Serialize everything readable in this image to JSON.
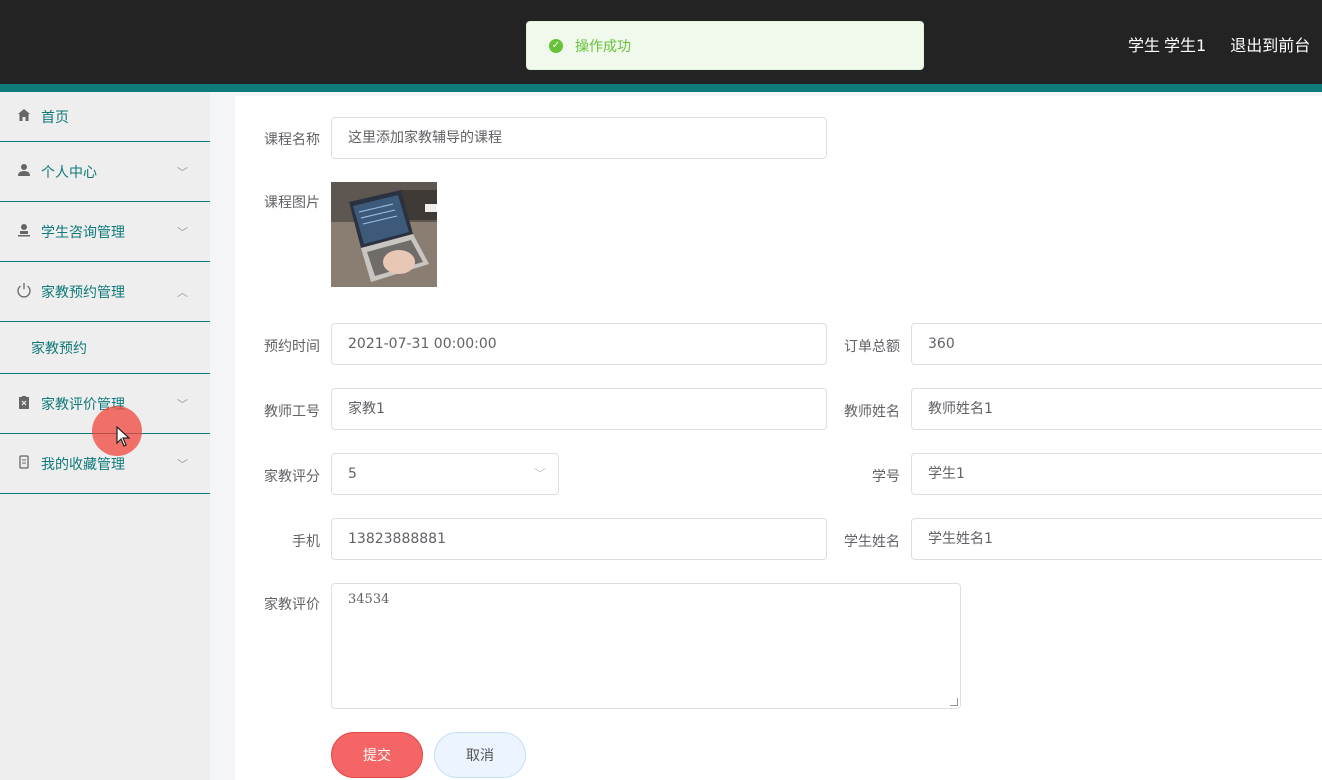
{
  "toast": {
    "message": "操作成功"
  },
  "header": {
    "user_role": "学生",
    "username": "学生1",
    "logout": "退出到前台"
  },
  "sidebar": {
    "items": [
      {
        "label": "首页",
        "icon": "home-icon"
      },
      {
        "label": "个人中心",
        "icon": "user-icon"
      },
      {
        "label": "学生咨询管理",
        "icon": "user-stand-icon"
      },
      {
        "label": "家教预约管理",
        "icon": "power-icon",
        "expanded": true
      },
      {
        "label": "家教评价管理",
        "icon": "clipboard-icon"
      },
      {
        "label": "我的收藏管理",
        "icon": "bookmark-icon"
      }
    ],
    "subitems": [
      {
        "label": "家教预约"
      }
    ]
  },
  "form": {
    "course_name": {
      "label": "课程名称",
      "value": "这里添加家教辅导的课程"
    },
    "course_image": {
      "label": "课程图片"
    },
    "appointment_time": {
      "label": "预约时间",
      "value": "2021-07-31 00:00:00"
    },
    "order_total": {
      "label": "订单总额",
      "value": "360"
    },
    "teacher_id": {
      "label": "教师工号",
      "value": "家教1"
    },
    "teacher_name": {
      "label": "教师姓名",
      "value": "教师姓名1"
    },
    "rating": {
      "label": "家教评分",
      "value": "5"
    },
    "student_id": {
      "label": "学号",
      "value": "学生1"
    },
    "phone": {
      "label": "手机",
      "value": "13823888881"
    },
    "student_name": {
      "label": "学生姓名",
      "value": "学生姓名1"
    },
    "review": {
      "label": "家教评价",
      "value": "34534"
    },
    "submit": "提交",
    "cancel": "取消"
  },
  "colors": {
    "accent": "#0f7a7a",
    "success": "#67c23a",
    "danger": "#f56565"
  }
}
